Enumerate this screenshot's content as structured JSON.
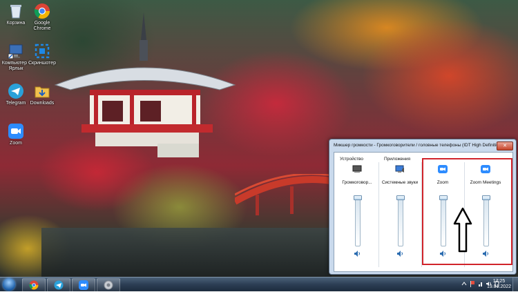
{
  "desktop": {
    "icons": [
      {
        "label": "Корзина",
        "icon": "recycle-bin-icon"
      },
      {
        "label": "Google Chrome",
        "icon": "chrome-icon"
      },
      {
        "label": "Компьютер - Ярлык",
        "icon": "computer-shortcut-icon"
      },
      {
        "label": "Скриншотер",
        "icon": "screenshoter-icon"
      },
      {
        "label": "Telegram",
        "icon": "telegram-icon"
      },
      {
        "label": "Downloads",
        "icon": "downloads-folder-icon"
      },
      {
        "label": "Zoom",
        "icon": "zoom-icon"
      }
    ]
  },
  "mixer": {
    "title": "Микшер громкости - Громкоговорители / головные телефоны (IDT High Definition Audio CODEC)",
    "close_label": "✕",
    "device_section_label": "Устройство",
    "apps_section_label": "Приложения",
    "channels": [
      {
        "name": "Громкоговор...",
        "icon": "speaker-device-icon",
        "level": 1.0
      },
      {
        "name": "Системные звуки",
        "icon": "system-sounds-icon",
        "level": 1.0
      },
      {
        "name": "Zoom",
        "icon": "zoom-icon",
        "level": 1.0
      },
      {
        "name": "Zoom Meetings",
        "icon": "zoom-icon",
        "level": 1.0
      }
    ]
  },
  "taskbar": {
    "buttons": [
      "chrome-icon",
      "telegram-icon",
      "zoom-icon",
      "volume-mixer-icon"
    ],
    "time": "17:25",
    "date": "19.01.2022"
  },
  "colors": {
    "highlight": "#d1232a",
    "zoom_blue": "#2d8cff",
    "telegram_blue": "#2aa1da"
  }
}
